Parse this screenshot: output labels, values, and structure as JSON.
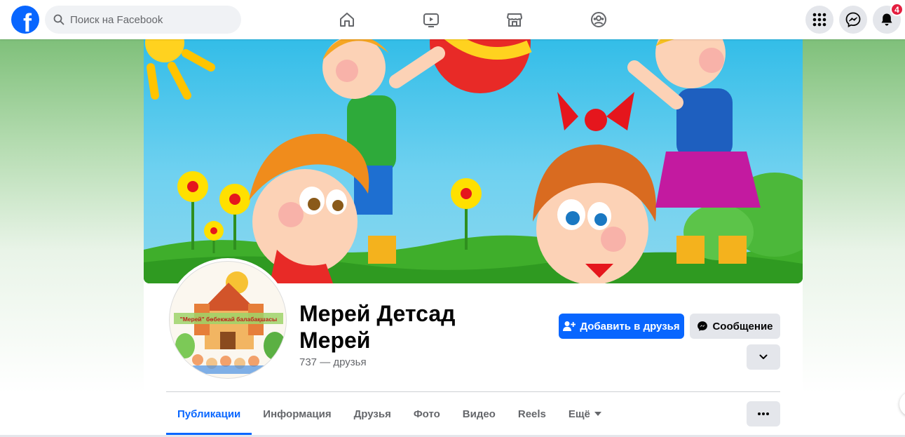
{
  "topbar": {
    "logo_icon": "facebook-logo",
    "search_placeholder": "Поиск на Facebook",
    "nav": [
      "home-icon",
      "video-icon",
      "marketplace-icon",
      "groups-icon"
    ],
    "right_buttons": [
      "menu-grid-icon",
      "messenger-icon",
      "notifications-bell-icon"
    ],
    "notifications_count": "4"
  },
  "profile": {
    "name": "Мерей Детсад Мерей",
    "friends": "737 — друзья",
    "avatar_text": "\"Мерей\" бөбекжай балабақшасы",
    "buttons": {
      "add_friend": "Добавить в друзья",
      "message": "Сообщение"
    }
  },
  "tabs": [
    {
      "label": "Публикации",
      "active": true
    },
    {
      "label": "Информация",
      "active": false
    },
    {
      "label": "Друзья",
      "active": false
    },
    {
      "label": "Фото",
      "active": false
    },
    {
      "label": "Видео",
      "active": false
    },
    {
      "label": "Reels",
      "active": false
    },
    {
      "label": "Ещё",
      "active": false
    }
  ],
  "colors": {
    "accent": "#0866ff",
    "badge": "#e41e3f",
    "secondary_button": "#e4e6eb",
    "muted_text": "#65676b"
  }
}
